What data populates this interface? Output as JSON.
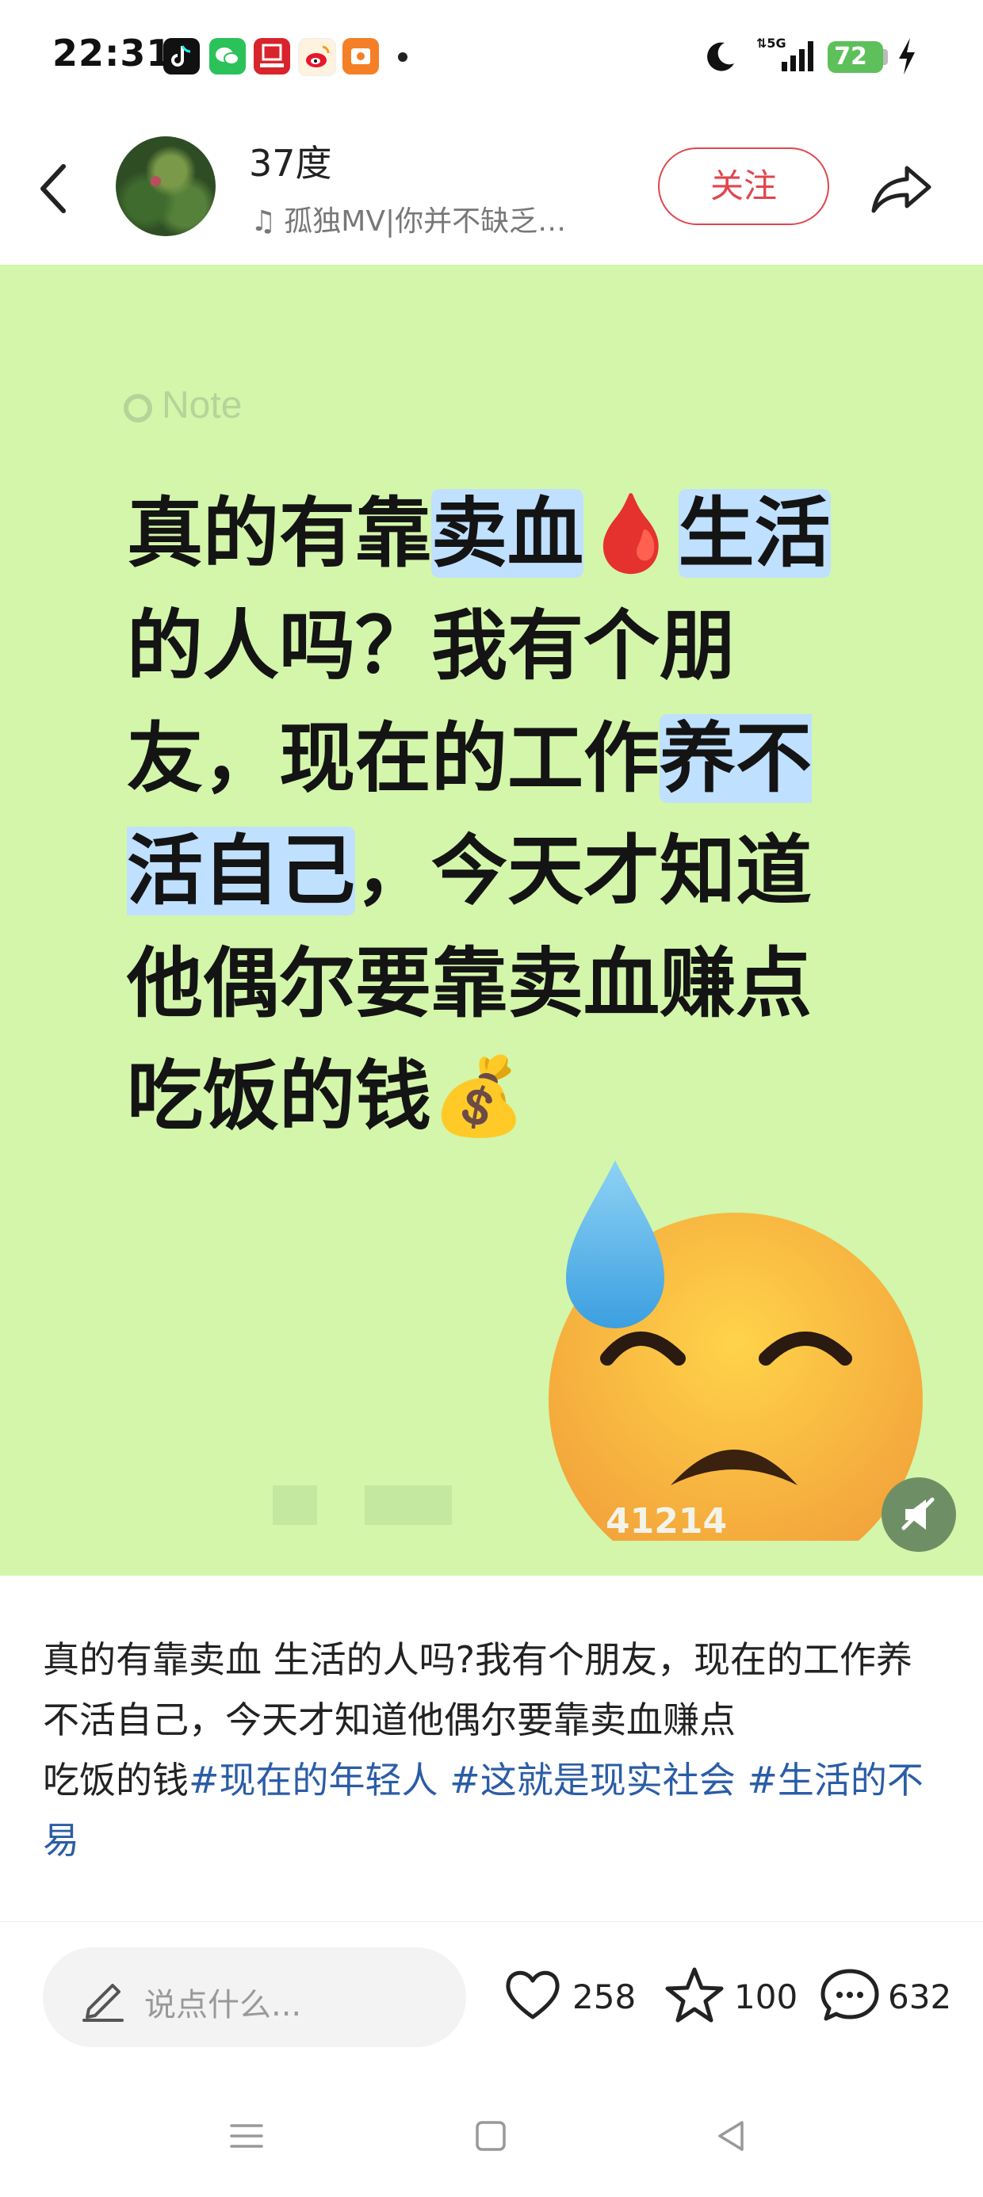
{
  "status_bar": {
    "time": "22:31",
    "apps": [
      "tiktok-icon",
      "wechat-icon",
      "finance-app-icon",
      "weibo-icon",
      "orange-app-icon"
    ],
    "network": "5G",
    "battery": "72"
  },
  "header": {
    "username": "37度",
    "music": "孤独MV|你并不缺乏…",
    "follow_label": "关注"
  },
  "card": {
    "brand": "Note",
    "headline_parts": [
      {
        "text": "真的有靠",
        "hl": false
      },
      {
        "text": "卖血",
        "hl": true
      },
      {
        "text": "🩸",
        "hl": false
      },
      {
        "text": "生活",
        "hl": true
      },
      {
        "text": "的人吗？我有个朋友，现在的工作",
        "hl": false
      },
      {
        "text": "养不活自己",
        "hl": true
      },
      {
        "text": "，今天才知道他偶尔要靠卖血赚点吃饭的钱",
        "hl": false
      },
      {
        "text": "💰",
        "hl": false
      }
    ],
    "watermark_id": "41214"
  },
  "caption": {
    "text": "真的有靠卖血 生活的人吗?我有个朋友，现在的工作养不活自己，今天才知道他偶尔要靠卖血赚点",
    "text2": "吃饭的钱",
    "tags": [
      "#现在的年轻人",
      "#这就是现实社会",
      "#生活的不易"
    ]
  },
  "actions": {
    "comment_placeholder": "说点什么...",
    "likes": "258",
    "favorites": "100",
    "comments": "632"
  },
  "colors": {
    "accent": "#e0464e",
    "card_bg": "#d3f6aa",
    "highlight": "#bfe0ff",
    "tag": "#2b5da6"
  }
}
